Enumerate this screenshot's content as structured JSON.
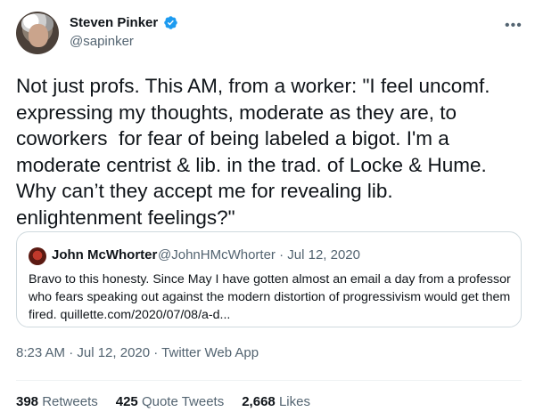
{
  "author": {
    "name": "Steven Pinker",
    "handle": "@sapinker",
    "verified_color": "#1d9bf0"
  },
  "more_icon": "more-horizontal-icon",
  "tweet": {
    "text": "Not just profs. This AM, from a worker: \"I feel uncomf. expressing my thoughts, moderate as they are, to coworkers  for fear of being labeled a bigot. I'm a moderate centrist & lib. in the trad. of Locke & Hume. Why can’t they accept me for revealing lib. enlightenment feelings?\""
  },
  "quote": {
    "name": "John McWhorter",
    "handle_date": "@JohnHMcWhorter · Jul 12, 2020",
    "text": "Bravo to this honesty. Since May I have gotten almost an email a day from a professor who fears speaking out against the modern distortion of progressivism would get them fired. quillette.com/2020/07/08/a-d..."
  },
  "meta": {
    "timestamp": "8:23 AM · Jul 12, 2020 · Twitter Web App"
  },
  "stats": {
    "retweets_count": "398",
    "retweets_label": "Retweets",
    "quotes_count": "425",
    "quotes_label": "Quote Tweets",
    "likes_count": "2,668",
    "likes_label": "Likes"
  }
}
